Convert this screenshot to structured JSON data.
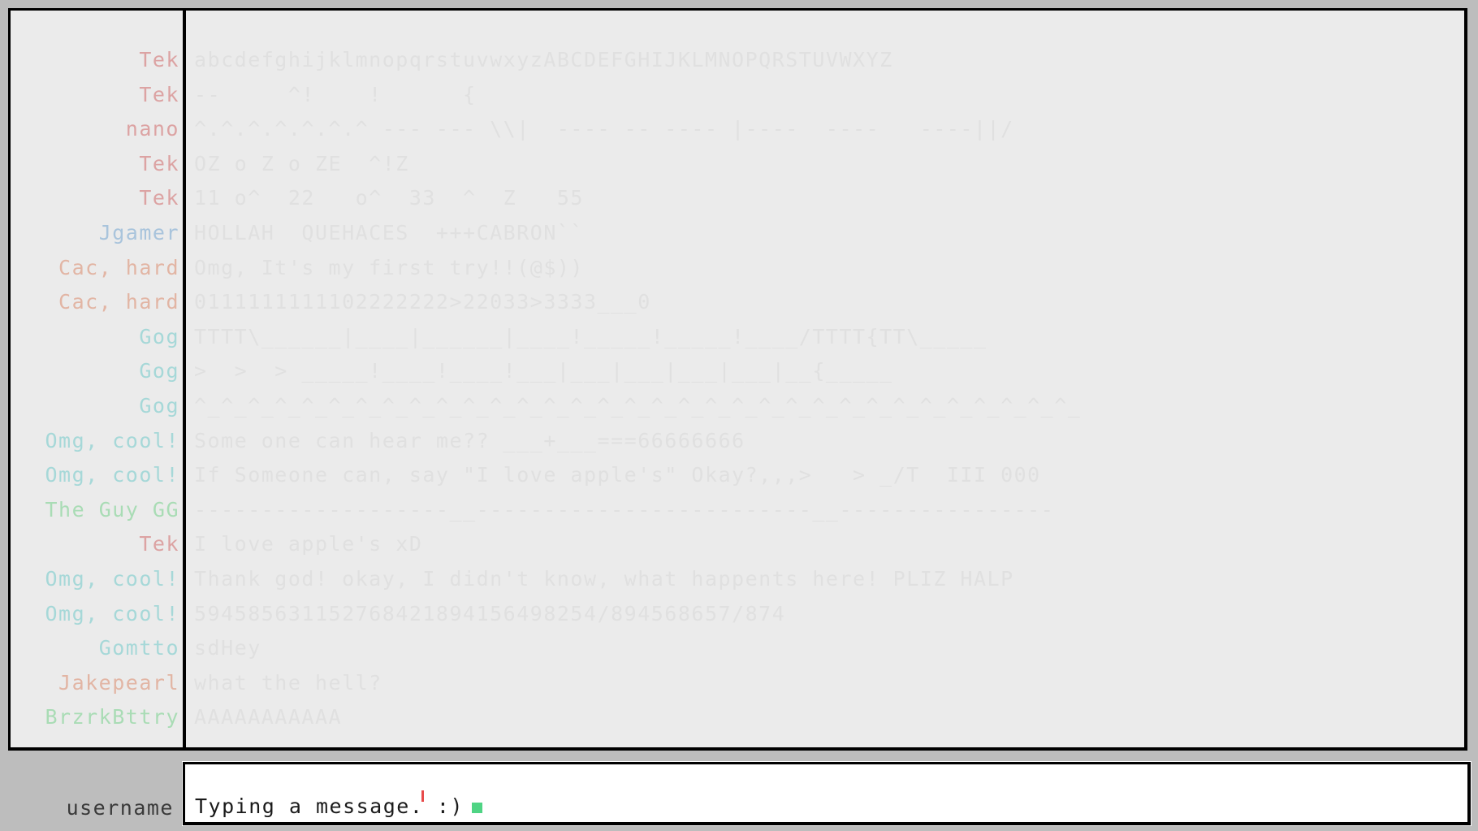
{
  "chat": {
    "messages": [
      {
        "name": "Tek",
        "name_color": "#dca3a3",
        "text": "abcdefghijklmnopqrstuvwxyzABCDEFGHIJKLMNOPQRSTUVWXYZ"
      },
      {
        "name": "Tek",
        "name_color": "#dca3a3",
        "text": "--     ^!    !      {"
      },
      {
        "name": "nano",
        "name_color": "#dca3a3",
        "text": "^.^.^.^.^.^.^ --- --- \\\\|  ---- -- ---- |----  ----   ----||/"
      },
      {
        "name": "Tek",
        "name_color": "#dca3a3",
        "text": "OZ o Z o ZE  ^!Z"
      },
      {
        "name": "Tek",
        "name_color": "#dca3a3",
        "text": "11 o^  22   o^  33  ^  Z   55"
      },
      {
        "name": "Jgamer",
        "name_color": "#a9c4dc",
        "text": "HOLLAH  QUEHACES  +++CABRON``"
      },
      {
        "name": "Cac, hard",
        "name_color": "#e2b5a4",
        "text": "Omg, It's my first try!!(@$))"
      },
      {
        "name": "Cac, hard",
        "name_color": "#e2b5a4",
        "text": "0111111111102222222>22033>3333___0"
      },
      {
        "name": "Gog",
        "name_color": "#a6d8d8",
        "text": "TTTT\\______|____|______|____!_____!_____!____/TTTT{TT\\_____"
      },
      {
        "name": "Gog",
        "name_color": "#a6d8d8",
        "text": ">  >  > _____!____!____!___|___|___|___|___|__{_____"
      },
      {
        "name": "Gog",
        "name_color": "#a6d8d8",
        "text": "^_^_^_^_^_^_^_^_^_^_^_^_^_^_^_^_^_^_^_^_^_^_^_^_^_^_^_^_^_^_^_^_^_"
      },
      {
        "name": "Omg, cool!",
        "name_color": "#a6d8d8",
        "text": "Some one can hear me?? ___+___===66666666"
      },
      {
        "name": "Omg, cool!",
        "name_color": "#a6d8d8",
        "text": "If Someone can, say \"I love apple's\" Okay?,,,>   > _/T  III 000"
      },
      {
        "name": "The Guy GG",
        "name_color": "#a9dcb5",
        "text": "-------------------__-------------------------__----------------"
      },
      {
        "name": "Tek",
        "name_color": "#dca3a3",
        "text": "I love apple's xD"
      },
      {
        "name": "Omg, cool!",
        "name_color": "#a6d8d8",
        "text": "Thank god! okay, I didn't know, what happents here! PLIZ HALP"
      },
      {
        "name": "Omg, cool!",
        "name_color": "#a6d8d8",
        "text": "594585631152768421894156498254/894568657/874"
      },
      {
        "name": "Gomtto",
        "name_color": "#a6d8d8",
        "text": "sdHey"
      },
      {
        "name": "Jakepearl",
        "name_color": "#e2b5a4",
        "text": "what the hell?"
      },
      {
        "name": "BrzrkBttry",
        "name_color": "#a9dcb5",
        "text": "AAAAAAAAAAA"
      }
    ]
  },
  "input": {
    "label": "username",
    "value": "Typing a message. :)",
    "caret_color": "#4fd484"
  }
}
